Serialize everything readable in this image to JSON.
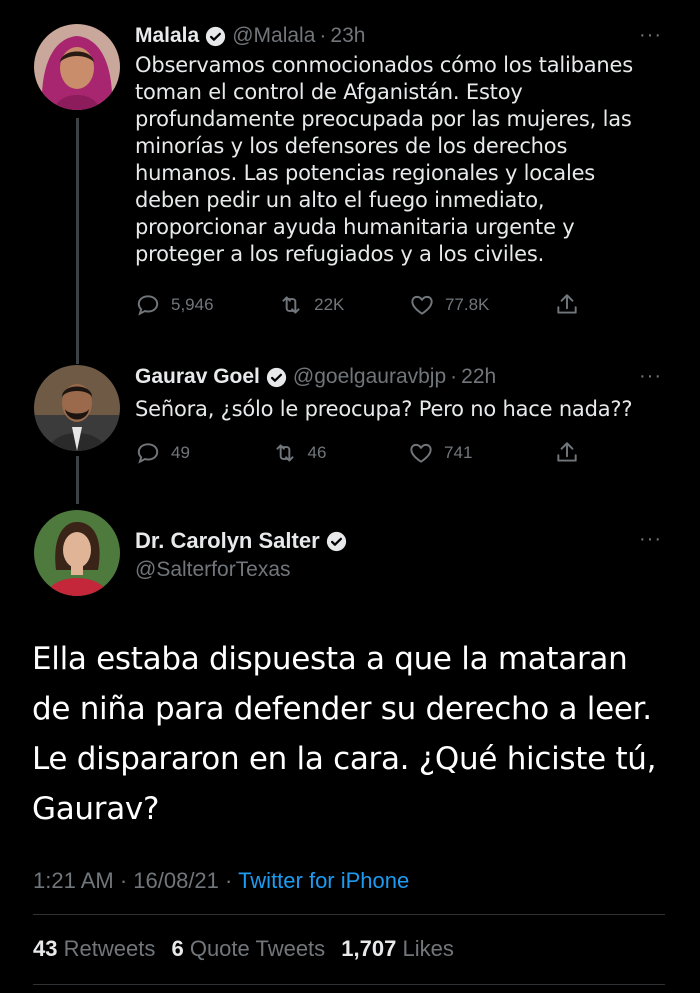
{
  "tweets": [
    {
      "name": "Malala",
      "handle": "@Malala",
      "time": "23h",
      "text": "Observamos conmocionados cómo los talibanes toman el control de Afganistán. Estoy profundamente preocupada por las mujeres, las minorías y los defensores de los derechos humanos. Las potencias regionales y locales deben pedir un alto el fuego inmediato, proporcionar ayuda humanitaria urgente y proteger a los refugiados y a los civiles.",
      "replies": "5,946",
      "retweets": "22K",
      "likes": "77.8K"
    },
    {
      "name": "Gaurav Goel",
      "handle": "@goelgauravbjp",
      "time": "22h",
      "text": "Señora, ¿sólo le preocupa? Pero no hace nada??",
      "replies": "49",
      "retweets": "46",
      "likes": "741"
    }
  ],
  "main": {
    "name": "Dr. Carolyn Salter",
    "handle": "@SalterforTexas",
    "text": "Ella estaba dispuesta a que la mataran de niña para defender su derecho a leer. Le dispararon en la cara. ¿Qué hiciste tú, Gaurav?",
    "timestamp": "1:21 AM · 16/08/21 · ",
    "source": "Twitter for iPhone",
    "retweets_count": "43",
    "retweets_label": "Retweets",
    "quotes_count": "6",
    "quotes_label": "Quote Tweets",
    "likes_count": "1,707",
    "likes_label": "Likes"
  },
  "more_label": "···",
  "colors": {
    "background": "#000000",
    "muted": "#71767b",
    "link": "#1d9bf0"
  }
}
